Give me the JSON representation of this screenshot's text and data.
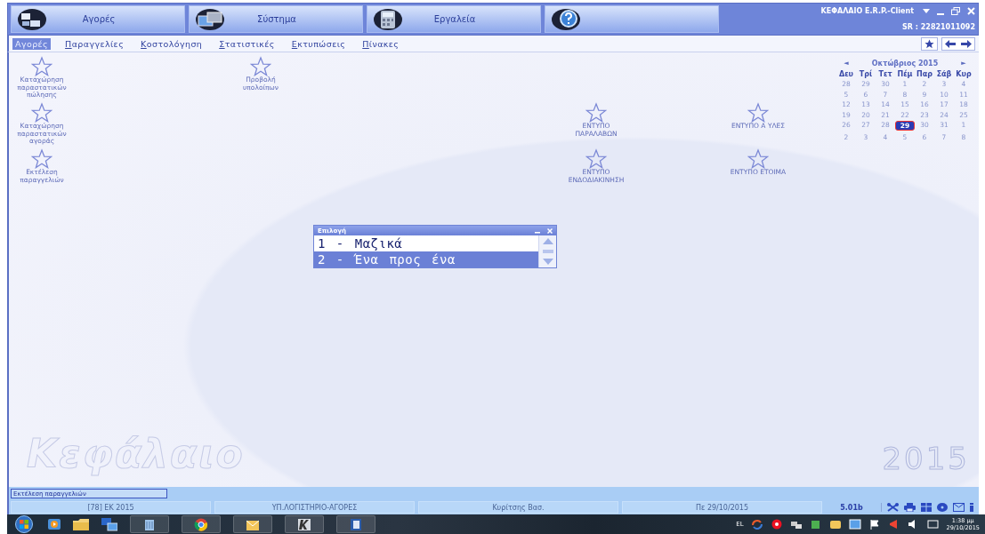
{
  "app": {
    "title": "ΚΕΦΑΛΑΙΟ E.R.P.-Client",
    "serial": "SR : 22821011092"
  },
  "toolbar": [
    {
      "label": "Αγορές",
      "kind": "purchases"
    },
    {
      "label": "Σύστημα",
      "kind": "system"
    },
    {
      "label": "Εργαλεία",
      "kind": "tools"
    },
    {
      "kind": "help"
    }
  ],
  "menu": [
    {
      "label": "Αγορές",
      "selected": true
    },
    {
      "label": "Παραγγελίες",
      "selected": false
    },
    {
      "label": "Κοστολόγηση",
      "selected": false
    },
    {
      "label": "Στατιστικές",
      "selected": false
    },
    {
      "label": "Εκτυπώσεις",
      "selected": false
    },
    {
      "label": "Πίνακες",
      "selected": false
    }
  ],
  "shortcuts": [
    {
      "label": "Καταχώρηση παραστατικών πώλησης"
    },
    {
      "label": "Προβολή υπολοίπων"
    },
    {
      "label": "Καταχώρηση παραστατικών αγοράς"
    },
    {
      "label": "Εκτέλεση παραγγελιών"
    },
    {
      "label": "ΕΝΤΥΠΟ ΠΑΡΑΛΑΒΩΝ"
    },
    {
      "label": "ΕΝΤΥΠΟ Α ΥΛΕΣ"
    },
    {
      "label": "ΕΝΤΥΠΟ ΕΝΔΟΔΙΑΚΙΝΗΣΗ"
    },
    {
      "label": "ΕΝΤΥΠΟ ΕΤΟΙΜΑ"
    }
  ],
  "calendar": {
    "prev": "◄",
    "month": "Οκτώβριος 2015",
    "next": "►",
    "weekdays": [
      "Δευ",
      "Τρί",
      "Τετ",
      "Πέμ",
      "Παρ",
      "Σάβ",
      "Κυρ"
    ],
    "days": [
      {
        "day": "28",
        "selected": false
      },
      {
        "day": "29",
        "selected": false
      },
      {
        "day": "30",
        "selected": false
      },
      {
        "day": "1",
        "selected": false
      },
      {
        "day": "2",
        "selected": false
      },
      {
        "day": "3",
        "selected": false
      },
      {
        "day": "4",
        "selected": false
      },
      {
        "day": "5",
        "selected": false
      },
      {
        "day": "6",
        "selected": false
      },
      {
        "day": "7",
        "selected": false
      },
      {
        "day": "8",
        "selected": false
      },
      {
        "day": "9",
        "selected": false
      },
      {
        "day": "10",
        "selected": false
      },
      {
        "day": "11",
        "selected": false
      },
      {
        "day": "12",
        "selected": false
      },
      {
        "day": "13",
        "selected": false
      },
      {
        "day": "14",
        "selected": false
      },
      {
        "day": "15",
        "selected": false
      },
      {
        "day": "16",
        "selected": false
      },
      {
        "day": "17",
        "selected": false
      },
      {
        "day": "18",
        "selected": false
      },
      {
        "day": "19",
        "selected": false
      },
      {
        "day": "20",
        "selected": false
      },
      {
        "day": "21",
        "selected": false
      },
      {
        "day": "22",
        "selected": false
      },
      {
        "day": "23",
        "selected": false
      },
      {
        "day": "24",
        "selected": false
      },
      {
        "day": "25",
        "selected": false
      },
      {
        "day": "26",
        "selected": false
      },
      {
        "day": "27",
        "selected": false
      },
      {
        "day": "28",
        "selected": false
      },
      {
        "day": "29",
        "selected": true
      },
      {
        "day": "30",
        "selected": false
      },
      {
        "day": "31",
        "selected": false
      },
      {
        "day": "1",
        "selected": false
      },
      {
        "day": "2",
        "selected": false
      },
      {
        "day": "3",
        "selected": false
      },
      {
        "day": "4",
        "selected": false
      },
      {
        "day": "5",
        "selected": false
      },
      {
        "day": "6",
        "selected": false
      },
      {
        "day": "7",
        "selected": false
      },
      {
        "day": "8",
        "selected": false
      }
    ]
  },
  "dialog": {
    "title": "Επιλογή",
    "items": [
      {
        "label": "1 - Μαζικά",
        "selected": false
      },
      {
        "label": "2 - Ένα προς ένα",
        "selected": true
      }
    ]
  },
  "logo_text": "Κεφάλαιο",
  "year_text": "2015",
  "status": {
    "message": "Εκτέλεση παραγγελιών",
    "segments": [
      "[78] ΕΚ 2015",
      "ΥΠ.ΛΟΓΙΣΤΗΡΙΟ-ΑΓΟΡΕΣ",
      "Κυρίτσης Βασ.",
      "Πε 29/10/2015"
    ],
    "version": "5.01b"
  },
  "taskbar": {
    "language": "EL",
    "time": "1:38 μμ",
    "date": "29/10/2015"
  }
}
